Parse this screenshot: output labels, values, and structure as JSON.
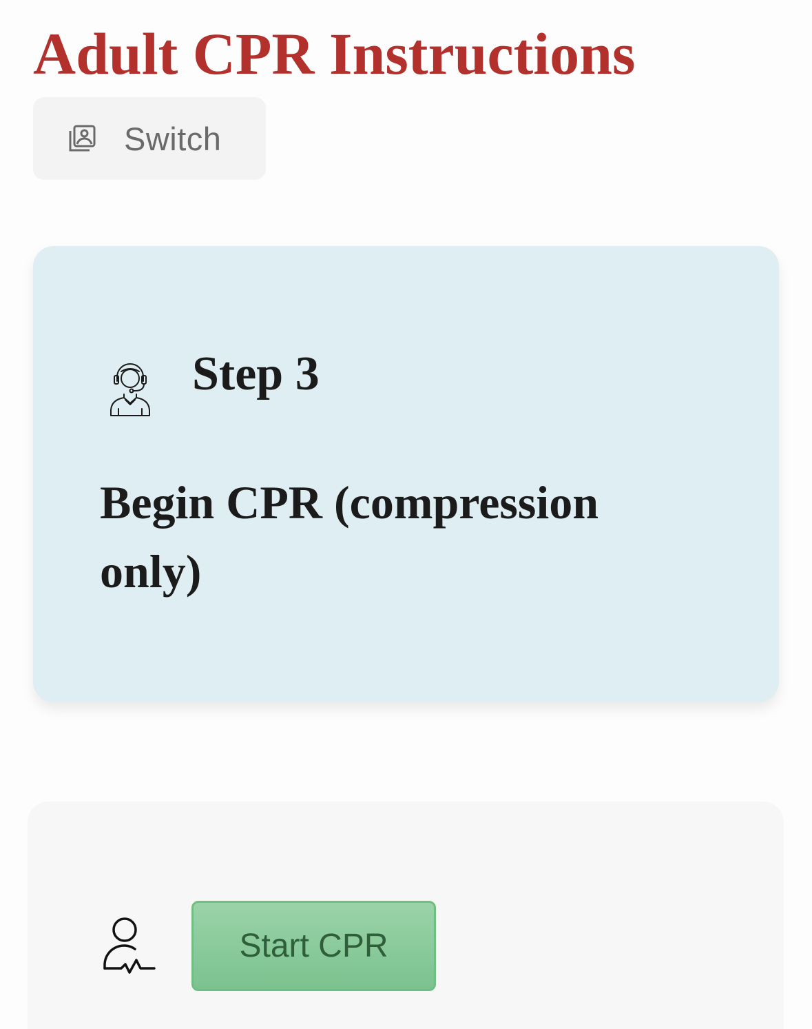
{
  "header": {
    "title": "Adult CPR Instructions"
  },
  "switch_button": {
    "label": "Switch",
    "icon": "photo-album-icon"
  },
  "step_card": {
    "icon": "call-operator-icon",
    "step_label": "Step 3",
    "instruction": "Begin CPR (compression only)",
    "background": "#dfeef2"
  },
  "action_card": {
    "icon": "patient-heartbeat-icon",
    "start_button_label": "Start CPR",
    "button_color": "#8ccb9c"
  },
  "colors": {
    "title": "#b3312c",
    "text": "#1b1b1b"
  }
}
